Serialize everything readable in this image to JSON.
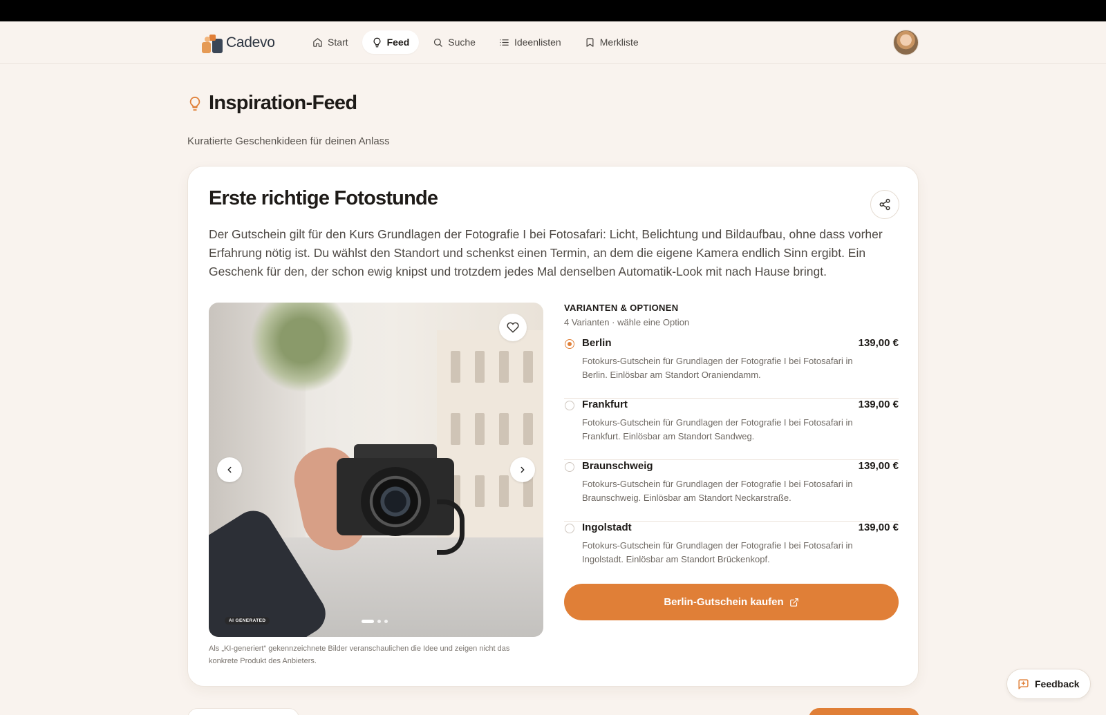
{
  "app": {
    "name": "Cadevo"
  },
  "nav": {
    "items": [
      {
        "label": "Start",
        "icon": "home-icon",
        "active": false
      },
      {
        "label": "Feed",
        "icon": "lightbulb-icon",
        "active": true
      },
      {
        "label": "Suche",
        "icon": "search-icon",
        "active": false
      },
      {
        "label": "Ideenlisten",
        "icon": "list-icon",
        "active": false
      },
      {
        "label": "Merkliste",
        "icon": "bookmark-icon",
        "active": false
      }
    ]
  },
  "page": {
    "title": "Inspiration-Feed",
    "subtitle": "Kuratierte Geschenkideen für deinen Anlass"
  },
  "card": {
    "title": "Erste richtige Fotostunde",
    "description": "Der Gutschein gilt für den Kurs Grundlagen der Fotografie I bei Fotosafari: Licht, Belichtung und Bildaufbau, ohne dass vorher Erfahrung nötig ist. Du wählst den Standort und schenkst einen Termin, an dem die eigene Kamera endlich Sinn ergibt. Ein Geschenk für den, der schon ewig knipst und trotzdem jedes Mal denselben Automatik-Look mit nach Hause bringt.",
    "gallery": {
      "ai_badge": "AI GENERATED",
      "slide_count": 3,
      "active_slide": 1,
      "caption": "Als „KI-generiert“ gekennzeichnete Bilder veranschaulichen die Idee und zeigen nicht das konkrete Produkt des Anbieters."
    },
    "variants": {
      "heading": "VARIANTEN & OPTIONEN",
      "summary": "4 Varianten · wähle eine Option",
      "selected_index": 0,
      "items": [
        {
          "name": "Berlin",
          "price": "139,00 €",
          "description": "Fotokurs-Gutschein für Grundlagen der Fotografie I bei Fotosafari in Berlin. Einlösbar am Standort Oraniendamm."
        },
        {
          "name": "Frankfurt",
          "price": "139,00 €",
          "description": "Fotokurs-Gutschein für Grundlagen der Fotografie I bei Fotosafari in Frankfurt. Einlösbar am Standort Sandweg."
        },
        {
          "name": "Braunschweig",
          "price": "139,00 €",
          "description": "Fotokurs-Gutschein für Grundlagen der Fotografie I bei Fotosafari in Braunschweig. Einlösbar am Standort Neckarstraße."
        },
        {
          "name": "Ingolstadt",
          "price": "139,00 €",
          "description": "Fotokurs-Gutschein für Grundlagen der Fotografie I bei Fotosafari in Ingolstadt. Einlösbar am Standort Brückenkopf."
        }
      ]
    },
    "buy_button": "Berlin-Gutschein kaufen"
  },
  "feedback": {
    "label": "Feedback"
  },
  "colors": {
    "accent": "#e07f37",
    "background": "#f9f3ee",
    "card": "#ffffff"
  }
}
